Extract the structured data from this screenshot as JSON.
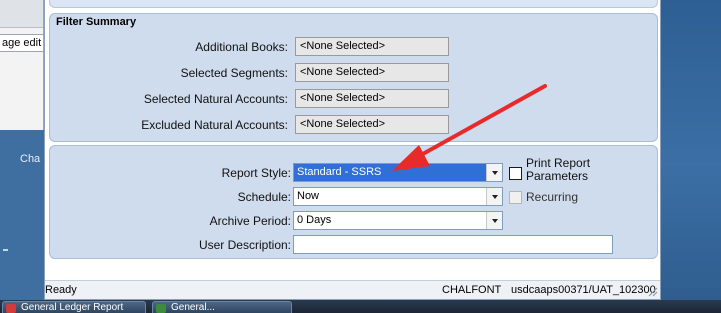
{
  "background": {
    "tab_label": "age edit",
    "desktop_label": "Cha"
  },
  "filter_summary": {
    "title": "Filter Summary",
    "rows": [
      {
        "label": "Additional Books:",
        "value": "<None Selected>"
      },
      {
        "label": "Selected Segments:",
        "value": "<None Selected>"
      },
      {
        "label": "Selected Natural Accounts:",
        "value": "<None Selected>"
      },
      {
        "label": "Excluded Natural Accounts:",
        "value": "<None Selected>"
      }
    ]
  },
  "report_options": {
    "report_style": {
      "label": "Report Style:",
      "value": "Standard - SSRS"
    },
    "print_params": {
      "label_line1": "Print Report",
      "label_line2": "Parameters",
      "checked": false
    },
    "schedule": {
      "label": "Schedule:",
      "value": "Now"
    },
    "recurring": {
      "label": "Recurring",
      "checked": false,
      "enabled": false
    },
    "archive_period": {
      "label": "Archive Period:",
      "value": "0 Days"
    },
    "user_description": {
      "label": "User Description:",
      "value": ""
    }
  },
  "status_bar": {
    "status": "Ready",
    "server": "CHALFONT",
    "connection": "usdcaaps00371/UAT_102300"
  },
  "taskbar": {
    "items": [
      {
        "label": "General Ledger Report",
        "icon": "report-app-icon",
        "color": "#d23b3b"
      },
      {
        "label": "General...",
        "icon": "document-app-icon",
        "color": "#3c8c3c"
      }
    ]
  },
  "annotation": {
    "color": "#e82a2a",
    "icon": "red-arrow-annotation"
  },
  "colors": {
    "panel_bg": "#cfdced",
    "selection": "#2f6fd6",
    "desktop": "#3f6ea1"
  }
}
